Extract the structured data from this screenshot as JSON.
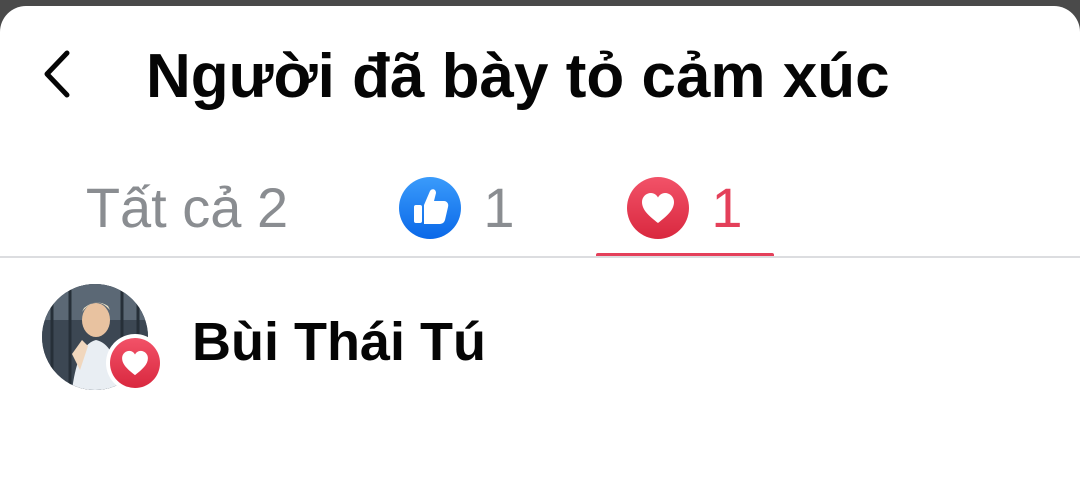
{
  "header": {
    "title": "Người đã bày tỏ cảm xúc",
    "back_icon": "chevron-left-icon"
  },
  "tabs": [
    {
      "label": "Tất cả 2",
      "selected": false
    },
    {
      "icon": "like-icon",
      "count": "1",
      "selected": false
    },
    {
      "icon": "love-icon",
      "count": "1",
      "selected": true
    }
  ],
  "reactions": [
    {
      "name": "Bùi Thái Tú",
      "avatar": "avatar",
      "reaction_icon": "love-icon"
    }
  ],
  "colors": {
    "like": "#1877f2",
    "love": "#e4405a",
    "inactive_tab": "#8a8d91",
    "text": "#050505",
    "divider": "#dcdde0"
  }
}
